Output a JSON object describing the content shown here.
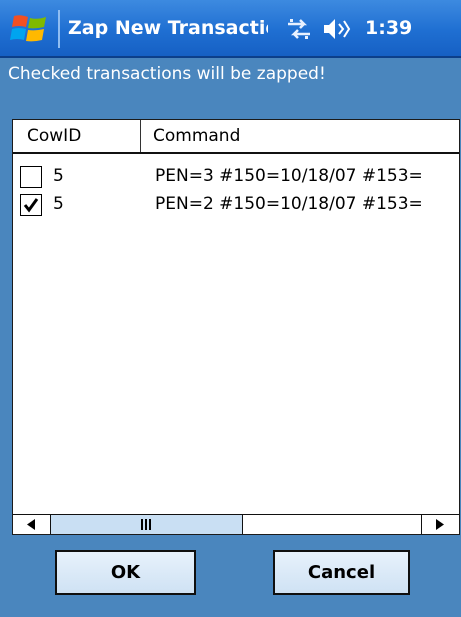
{
  "titlebar": {
    "title": "Zap New Transaction",
    "clock": "1:39",
    "icons": [
      "windows-logo-icon",
      "sync-icon",
      "sound-icon"
    ]
  },
  "instruction": "Checked transactions will be zapped!",
  "list": {
    "columns": [
      "CowID",
      "Command"
    ],
    "rows": [
      {
        "checked": false,
        "cow_id": "5",
        "command": "PEN=3 #150=10/18/07 #153="
      },
      {
        "checked": true,
        "cow_id": "5",
        "command": "PEN=2  #150=10/18/07 #153="
      }
    ]
  },
  "buttons": {
    "ok": "OK",
    "cancel": "Cancel"
  }
}
